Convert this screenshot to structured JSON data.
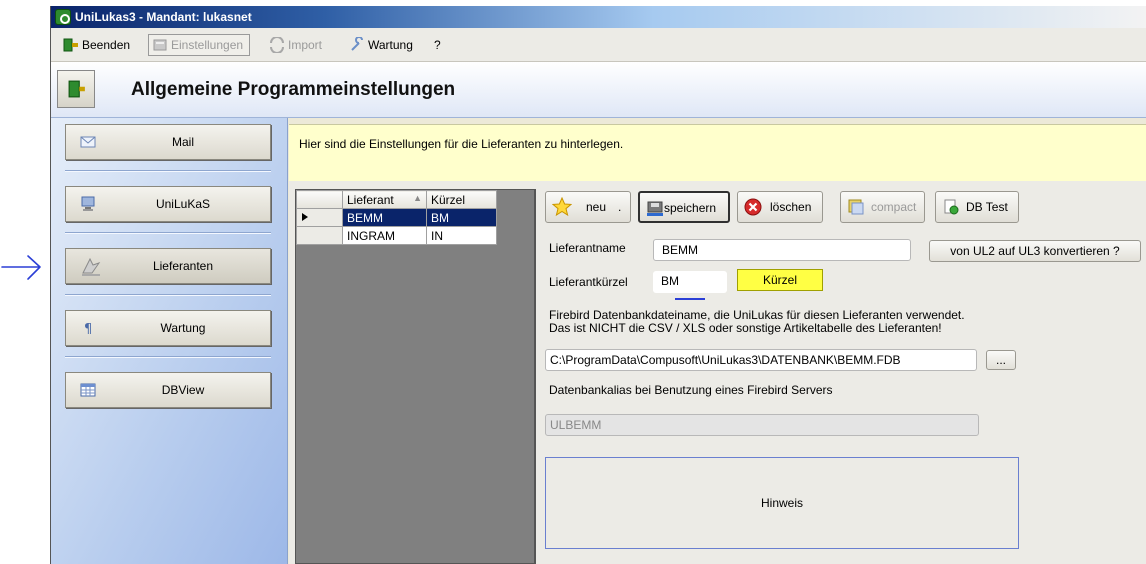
{
  "window": {
    "title": "UniLukas3 - Mandant: lukasnet",
    "app_icon": "unilukas-app-icon"
  },
  "menu": {
    "items": [
      {
        "label": "Beenden",
        "icon": "exit-door-icon",
        "enabled": true
      },
      {
        "label": "Einstellungen",
        "icon": "settings-icon",
        "enabled": false
      },
      {
        "label": "Import",
        "icon": "import-arrows-icon",
        "enabled": false
      },
      {
        "label": "Wartung",
        "icon": "wrench-icon",
        "enabled": true
      },
      {
        "label": "?",
        "enabled": true
      }
    ]
  },
  "header": {
    "title": "Allgemeine Programmeinstellungen",
    "icon": "exit-door-icon"
  },
  "sidebar": {
    "items": [
      {
        "label": "Mail",
        "icon": "envelope-icon"
      },
      {
        "label": "UniLuKaS",
        "icon": "computer-icon"
      },
      {
        "label": "Lieferanten",
        "icon": "suppliers-icon",
        "active": true
      },
      {
        "label": "Wartung",
        "icon": "paragraph-icon"
      },
      {
        "label": "DBView",
        "icon": "table-icon"
      }
    ]
  },
  "info": {
    "text": "Hier sind die Einstellungen für die Lieferanten zu hinterlegen."
  },
  "grid": {
    "columns": [
      "Lieferant",
      "Kürzel"
    ],
    "sort_indicator": "▲",
    "rows": [
      {
        "lieferant": "BEMM",
        "kuerzel": "BM",
        "selected": true
      },
      {
        "lieferant": "INGRAM",
        "kuerzel": "IN",
        "selected": false
      }
    ]
  },
  "toolbar": {
    "neu": "neu",
    "neu_suffix": ".",
    "speichern": "speichern",
    "loeschen": "löschen",
    "compact": "compact",
    "db_test": "DB Test"
  },
  "form": {
    "lieferantname_label": "Lieferantname",
    "lieferantname_value": "BEMM",
    "konvertieren_label": "von UL2 auf UL3 konvertieren ?",
    "lieferantkuerzel_label": "Lieferantkürzel",
    "lieferantkuerzel_value": "BM",
    "kuerzel_button": "Kürzel",
    "firebird_line1": "Firebird Datenbankdateiname, die UniLukas für diesen Lieferanten verwendet.",
    "firebird_line2": "Das ist NICHT die CSV / XLS oder sonstige Artikeltabelle des Lieferanten!",
    "db_path": "C:\\ProgramData\\Compusoft\\UniLukas3\\DATENBANK\\BEMM.FDB",
    "browse_label": "...",
    "alias_label": "Datenbankalias bei Benutzung eines Firebird Servers",
    "alias_value": "ULBEMM",
    "hinweis": "Hinweis"
  },
  "colors": {
    "selection": "#0a246a",
    "info_background": "#ffffcc",
    "kuerzel_button": "#ffff44",
    "annotation": "#2b3fd6"
  }
}
